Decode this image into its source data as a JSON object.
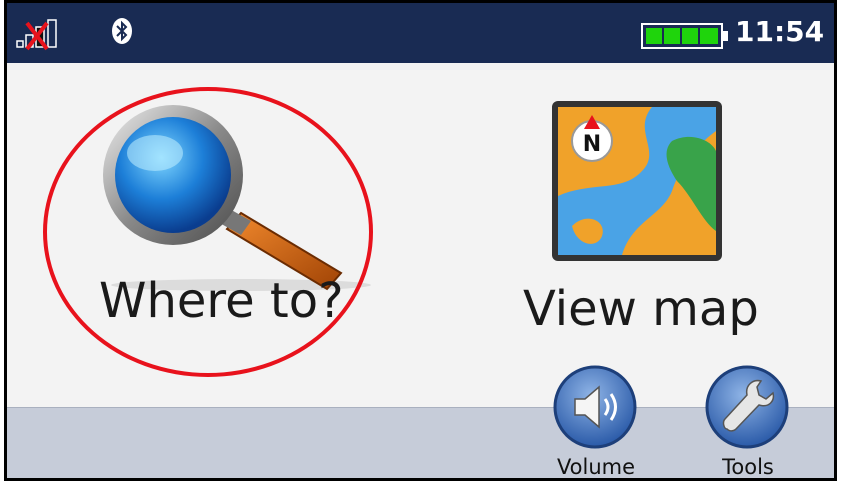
{
  "statusbar": {
    "signal_icon": "no-signal-icon",
    "bluetooth_icon": "bluetooth-icon",
    "battery_icon": "battery-full-icon",
    "time": "11:54"
  },
  "menu": {
    "where_to": {
      "label": "Where to?",
      "icon": "magnifier-icon"
    },
    "view_map": {
      "label": "View map",
      "icon": "map-icon"
    }
  },
  "bottom": {
    "volume": {
      "label": "Volume",
      "icon": "speaker-icon"
    },
    "tools": {
      "label": "Tools",
      "icon": "wrench-icon"
    }
  },
  "colors": {
    "statusbar_bg": "#192b53",
    "bottombar_bg": "#c6ccd9",
    "highlight": "#e8121c",
    "battery": "#1fd40c"
  }
}
